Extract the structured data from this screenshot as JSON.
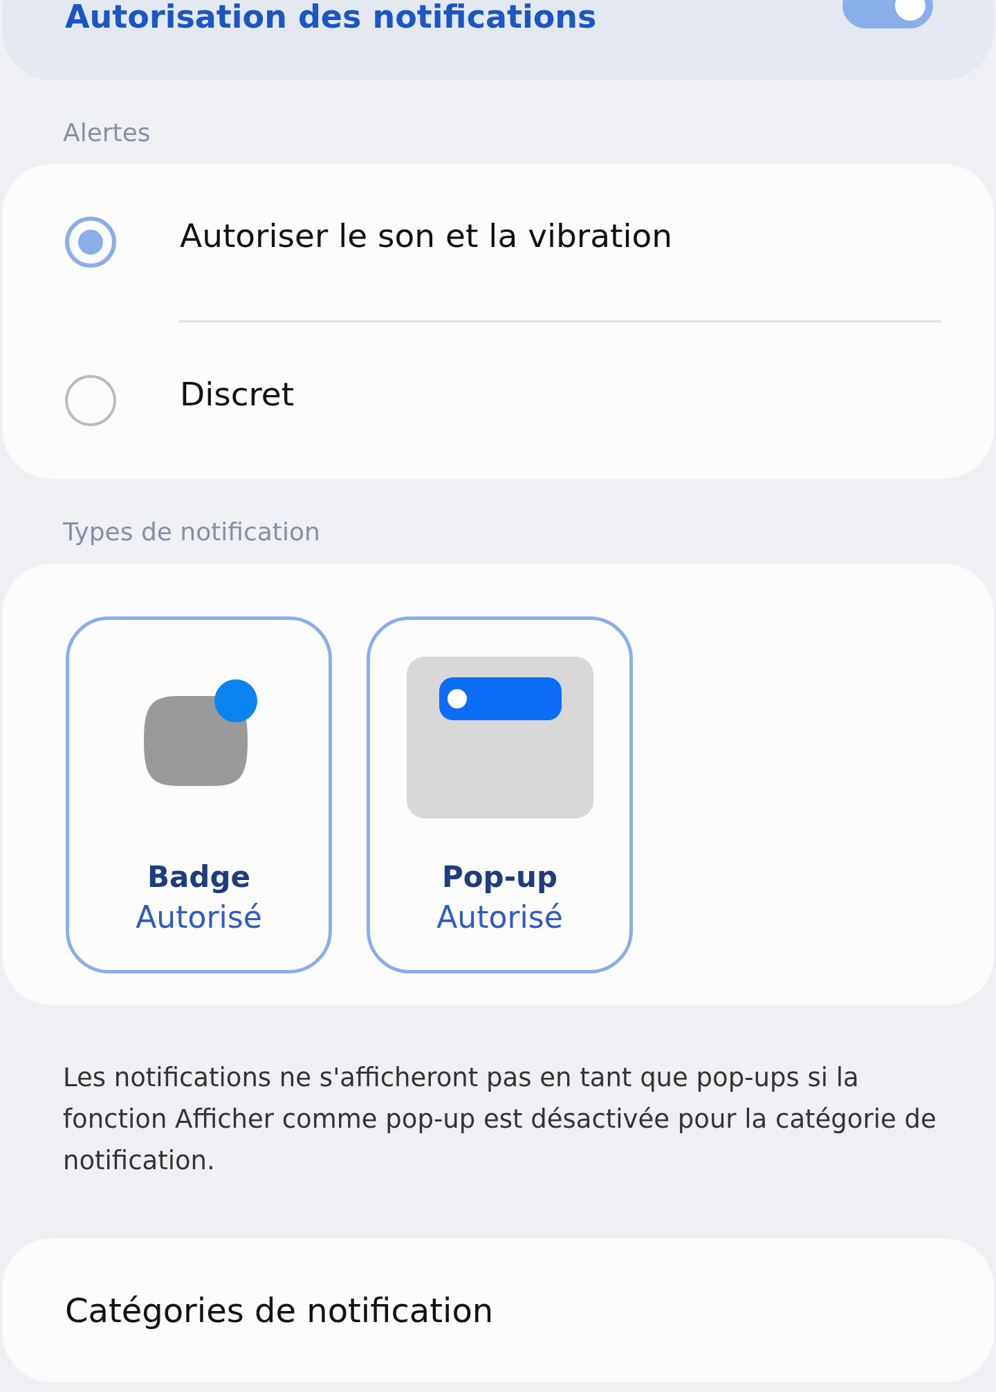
{
  "permission": {
    "title": "Autorisation des notifications",
    "on": true
  },
  "alerts": {
    "label": "Alertes",
    "options": [
      {
        "label": "Autoriser le son et la vibration",
        "selected": true
      },
      {
        "label": "Discret",
        "selected": false
      }
    ]
  },
  "types": {
    "label": "Types de notification",
    "tiles": [
      {
        "kind": "badge",
        "title": "Badge",
        "status": "Autorisé",
        "selected": true
      },
      {
        "kind": "popup",
        "title": "Pop-up",
        "status": "Autorisé",
        "selected": true
      }
    ]
  },
  "note": "Les notifications ne s'afficheront pas en tant que pop-ups si la fonction Afficher comme pop-up est désactivée pour la catégorie de notification.",
  "categories": {
    "label": "Catégories de notification"
  }
}
